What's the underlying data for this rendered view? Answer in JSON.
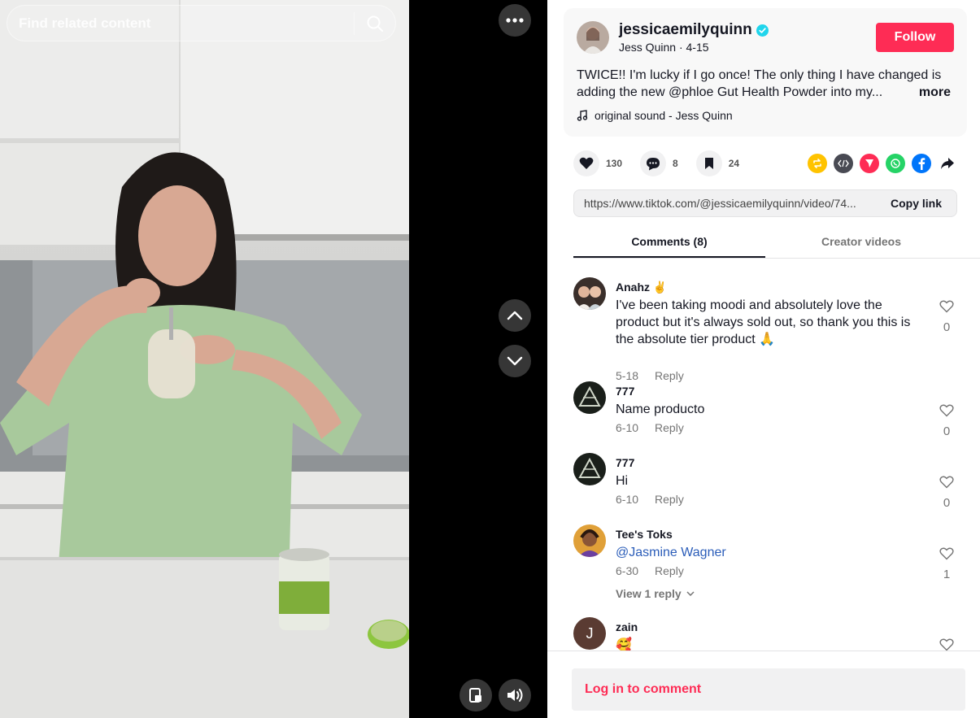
{
  "search": {
    "placeholder": "Find related content"
  },
  "author": {
    "username": "jessicaemilyquinn",
    "display_name": "Jess Quinn",
    "date": "4-15",
    "follow_label": "Follow",
    "caption_line1": "TWICE!! I'm lucky if I go once! The only thing I have changed is",
    "caption_line2": "adding the new @phloe Gut Health Powder into my...",
    "more_label": "more",
    "sound": "original sound - Jess Quinn"
  },
  "actions": {
    "likes": "130",
    "comments": "8",
    "saves": "24"
  },
  "share": {
    "url": "https://www.tiktok.com/@jessicaemilyquinn/video/74...",
    "copy_label": "Copy link",
    "icons": [
      "repost-icon",
      "embed-icon",
      "send-icon",
      "whatsapp-icon",
      "facebook-icon",
      "share-arrow-icon"
    ]
  },
  "tabs": [
    {
      "label": "Comments (8)",
      "active": true
    },
    {
      "label": "Creator videos",
      "active": false
    }
  ],
  "comments": [
    {
      "user": "Anahz ✌️",
      "text": "I've been taking moodi and absolutely love the product but it's always sold out, so thank you this is the absolute tier product 🙏",
      "date": "5-18",
      "reply": "Reply",
      "likes": "0"
    },
    {
      "user": "777",
      "text": "Name producto",
      "date": "6-10",
      "reply": "Reply",
      "likes": "0"
    },
    {
      "user": "777",
      "text": "Hi",
      "date": "6-10",
      "reply": "Reply",
      "likes": "0"
    },
    {
      "user": "Tee's Toks",
      "text": "@Jasmine Wagner",
      "date": "6-30",
      "reply": "Reply",
      "likes": "1",
      "view_replies": "View 1 reply"
    },
    {
      "user": "zain",
      "text": "🥰",
      "avatar_letter": "J"
    }
  ],
  "login": {
    "label": "Log in to comment"
  },
  "colors": {
    "brand": "#fe2c55",
    "verified": "#20d5ec",
    "mention": "#2b5db9"
  }
}
